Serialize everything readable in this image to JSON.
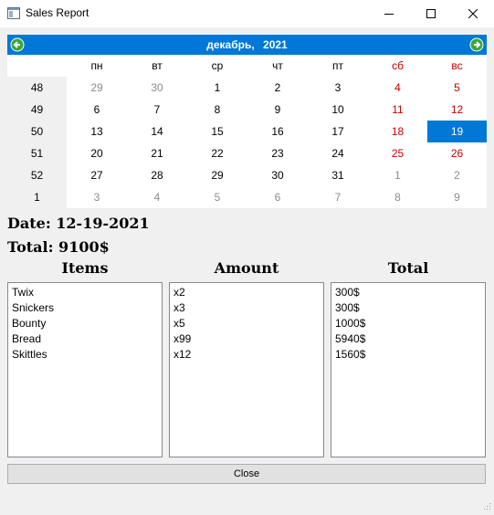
{
  "window": {
    "title": "Sales Report"
  },
  "calendar": {
    "month": "декабрь,",
    "year": "2021",
    "weekdays": [
      {
        "label": "пн",
        "weekend": false
      },
      {
        "label": "вт",
        "weekend": false
      },
      {
        "label": "ср",
        "weekend": false
      },
      {
        "label": "чт",
        "weekend": false
      },
      {
        "label": "пт",
        "weekend": false
      },
      {
        "label": "сб",
        "weekend": true
      },
      {
        "label": "вс",
        "weekend": true
      }
    ],
    "rows": [
      {
        "week": "48",
        "days": [
          {
            "d": "29",
            "state": "other"
          },
          {
            "d": "30",
            "state": "other"
          },
          {
            "d": "1",
            "state": "wd"
          },
          {
            "d": "2",
            "state": "wd"
          },
          {
            "d": "3",
            "state": "wd"
          },
          {
            "d": "4",
            "state": "we"
          },
          {
            "d": "5",
            "state": "we"
          }
        ]
      },
      {
        "week": "49",
        "days": [
          {
            "d": "6",
            "state": "wd"
          },
          {
            "d": "7",
            "state": "wd"
          },
          {
            "d": "8",
            "state": "wd"
          },
          {
            "d": "9",
            "state": "wd"
          },
          {
            "d": "10",
            "state": "wd"
          },
          {
            "d": "11",
            "state": "we"
          },
          {
            "d": "12",
            "state": "we"
          }
        ]
      },
      {
        "week": "50",
        "days": [
          {
            "d": "13",
            "state": "wd"
          },
          {
            "d": "14",
            "state": "wd"
          },
          {
            "d": "15",
            "state": "wd"
          },
          {
            "d": "16",
            "state": "wd"
          },
          {
            "d": "17",
            "state": "wd"
          },
          {
            "d": "18",
            "state": "we"
          },
          {
            "d": "19",
            "state": "sel"
          }
        ]
      },
      {
        "week": "51",
        "days": [
          {
            "d": "20",
            "state": "wd"
          },
          {
            "d": "21",
            "state": "wd"
          },
          {
            "d": "22",
            "state": "wd"
          },
          {
            "d": "23",
            "state": "wd"
          },
          {
            "d": "24",
            "state": "wd"
          },
          {
            "d": "25",
            "state": "we"
          },
          {
            "d": "26",
            "state": "we"
          }
        ]
      },
      {
        "week": "52",
        "days": [
          {
            "d": "27",
            "state": "wd"
          },
          {
            "d": "28",
            "state": "wd"
          },
          {
            "d": "29",
            "state": "wd"
          },
          {
            "d": "30",
            "state": "wd"
          },
          {
            "d": "31",
            "state": "wd"
          },
          {
            "d": "1",
            "state": "other"
          },
          {
            "d": "2",
            "state": "other"
          }
        ]
      },
      {
        "week": "1",
        "days": [
          {
            "d": "3",
            "state": "other"
          },
          {
            "d": "4",
            "state": "other"
          },
          {
            "d": "5",
            "state": "other"
          },
          {
            "d": "6",
            "state": "other"
          },
          {
            "d": "7",
            "state": "other"
          },
          {
            "d": "8",
            "state": "other"
          },
          {
            "d": "9",
            "state": "other"
          }
        ]
      }
    ],
    "colors": {
      "accent": "#0078d7",
      "weekend": "#c00000",
      "other_month": "#8c8c8c"
    }
  },
  "summary": {
    "date_label": "Date: 12-19-2021",
    "total_label": "Total: 9100$"
  },
  "columns": {
    "items_header": "Items",
    "amount_header": "Amount",
    "total_header": "Total",
    "items": [
      "Twix",
      "Snickers",
      "Bounty",
      "Bread",
      "Skittles"
    ],
    "amounts": [
      "x2",
      "x3",
      "x5",
      "x99",
      "x12"
    ],
    "totals": [
      "300$",
      "300$",
      "1000$",
      "5940$",
      "1560$"
    ]
  },
  "buttons": {
    "close_label": "Close"
  },
  "icons": {
    "app": "window-app-icon",
    "minimize": "minimize-icon",
    "maximize": "maximize-icon",
    "close": "close-icon",
    "prev": "arrow-left-icon",
    "next": "arrow-right-icon",
    "grip": "resize-grip-icon"
  }
}
